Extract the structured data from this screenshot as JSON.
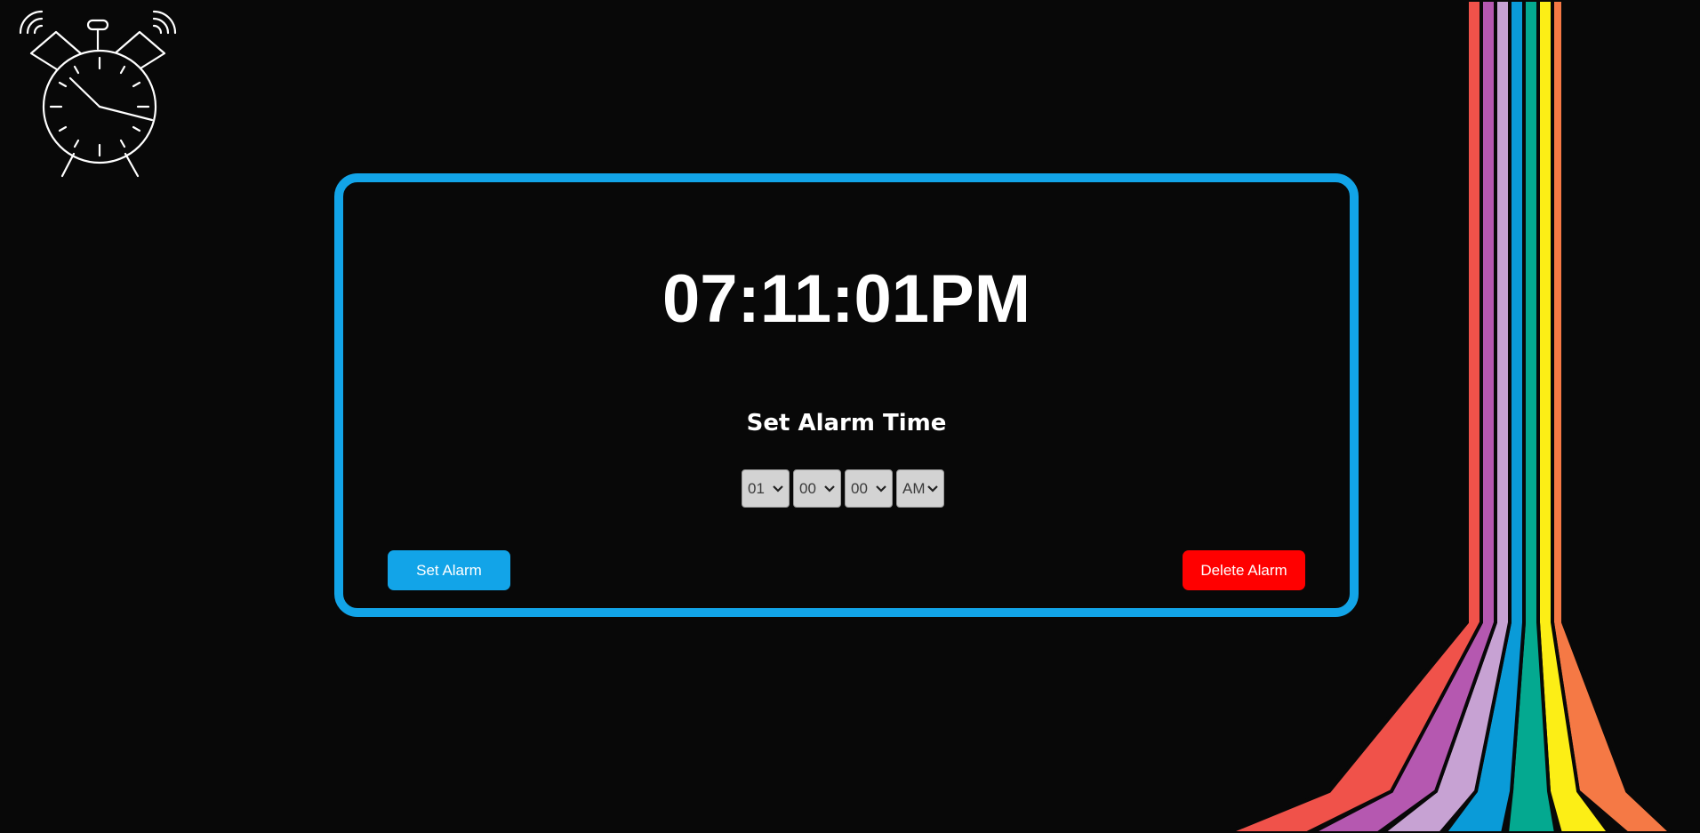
{
  "clock": {
    "time": "07:11:01PM"
  },
  "alarm": {
    "heading": "Set Alarm Time",
    "selects": {
      "hour": "01",
      "minute": "00",
      "second": "00",
      "ampm": "AM"
    },
    "set_button": "Set Alarm",
    "delete_button": "Delete Alarm"
  },
  "colors": {
    "background": "#080808",
    "accent": "#12a4e8",
    "danger": "#ff0000",
    "stripes": [
      "#f0524a",
      "#b558b0",
      "#c7a2d3",
      "#0a9bd8",
      "#04a990",
      "#fcee16",
      "#f57945"
    ]
  },
  "icons": {
    "logo": "alarm-clock-icon",
    "dropdown": "chevron-down-icon"
  }
}
